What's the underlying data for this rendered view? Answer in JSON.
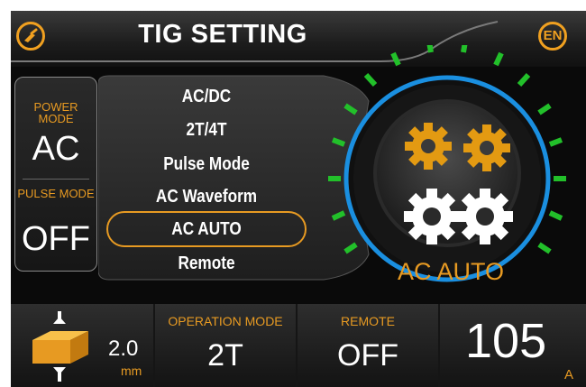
{
  "header": {
    "title": "TIG SETTING",
    "home_icon": "torch-icon",
    "lang_label": "EN"
  },
  "status": {
    "power_mode_label": "POWER MODE",
    "power_mode_value": "AC",
    "pulse_mode_label": "PULSE MODE",
    "pulse_mode_value": "OFF"
  },
  "menu": {
    "items": [
      "AC/DC",
      "2T/4T",
      "Pulse Mode",
      "AC Waveform",
      "AC AUTO",
      "Remote"
    ],
    "selected": "AC AUTO"
  },
  "dial": {
    "label": "AC AUTO",
    "icon": "gears-icon"
  },
  "bottom": {
    "thickness_value": "2.0",
    "thickness_unit": "mm",
    "operation_mode_label": "OPERATION MODE",
    "operation_mode_value": "2T",
    "remote_label": "REMOTE",
    "remote_value": "OFF",
    "current_value": "105",
    "current_unit": "A"
  },
  "colors": {
    "accent": "#e79a22",
    "ring_blue": "#1a8fe0",
    "tick_green": "#22c02a",
    "background": "#0a0a0a"
  }
}
